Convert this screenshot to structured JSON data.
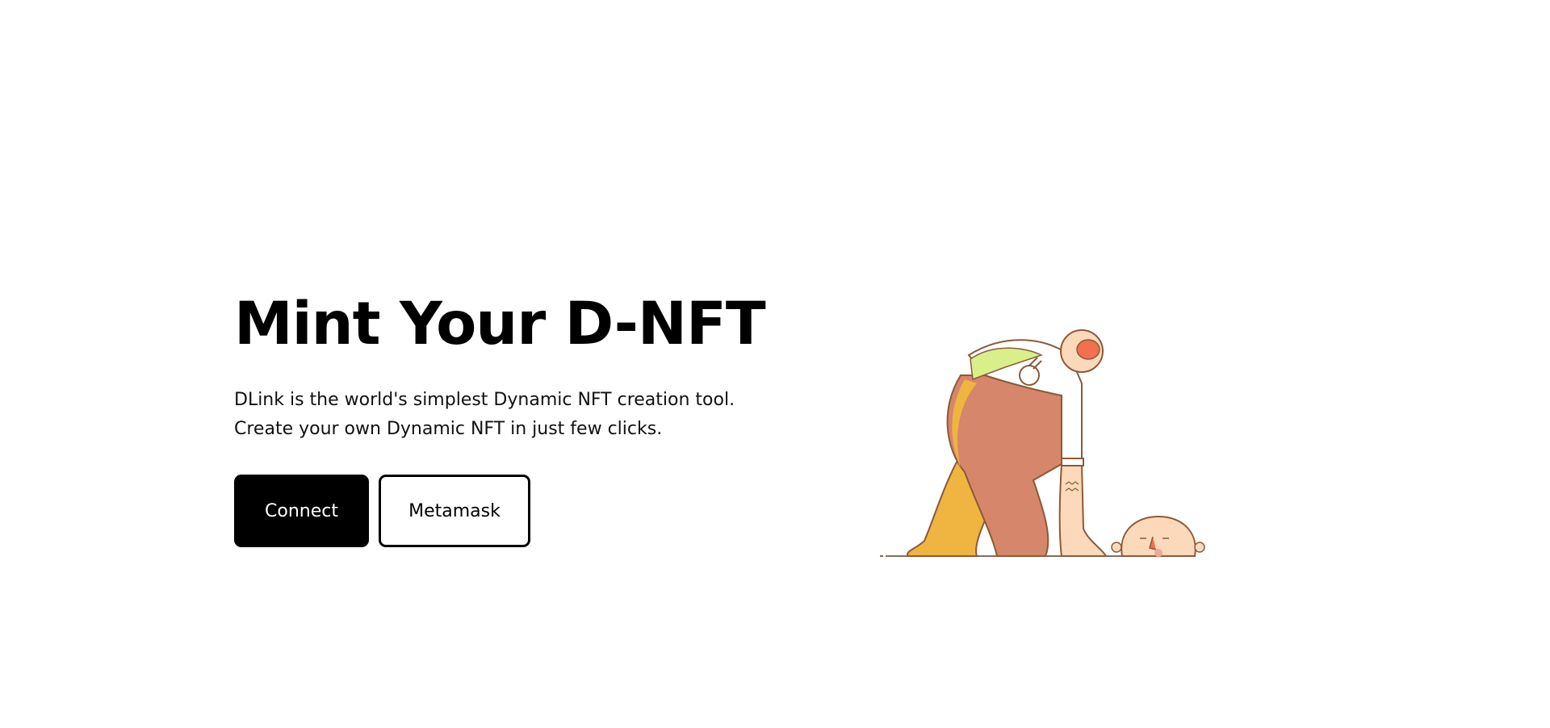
{
  "hero": {
    "title": "Mint Your D-NFT",
    "description_line1": "DLink is the world's simplest Dynamic NFT creation tool.",
    "description_line2": "Create your own Dynamic NFT in just few clicks."
  },
  "actions": {
    "connect_label": "Connect",
    "metamask_label": "Metamask"
  },
  "illustration": {
    "icon": "headless-figure-illustration"
  },
  "colors": {
    "primary_button_bg": "#000000",
    "primary_button_text": "#ffffff",
    "secondary_button_bg": "#ffffff",
    "secondary_button_border": "#000000",
    "illustration_orange": "#d6866a",
    "illustration_yellow": "#f0b440",
    "illustration_skin": "#fdd9bb"
  }
}
